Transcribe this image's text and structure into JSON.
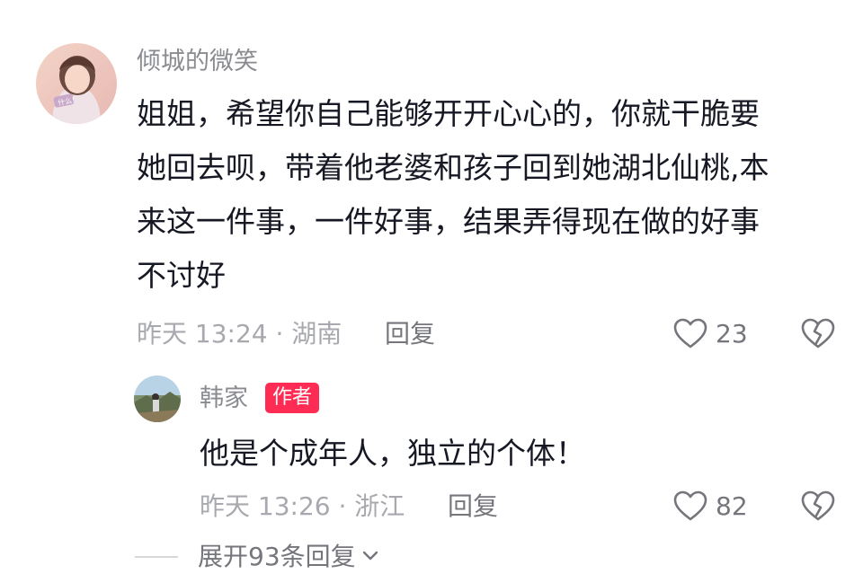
{
  "main_comment": {
    "username": "倾城的微笑",
    "avatar_icon": "avatar-girl-photo",
    "lines": [
      "姐姐，希望你自己能够开开心心的，你就干脆要",
      "她回去呗，带着他老婆和孩子回到她湖北仙桃,本",
      "来这一件事，一件好事，结果弄得现在做的好事",
      "不讨好"
    ],
    "meta": "昨天 13:24 · 湖南",
    "reply_label": "回复",
    "like_count": "23",
    "like_icon": "heart-outline-icon",
    "dislike_icon": "broken-heart-icon"
  },
  "reply_comment": {
    "username": "韩家",
    "badge": "作者",
    "avatar_icon": "avatar-landscape-photo",
    "text": "他是个成年人，独立的个体！",
    "meta": "昨天 13:26 · 浙江",
    "reply_label": "回复",
    "like_count": "82",
    "like_icon": "heart-outline-icon",
    "dislike_icon": "broken-heart-icon"
  },
  "expand": {
    "label": "展开93条回复",
    "icon": "chevron-down-icon"
  },
  "colors": {
    "badge": "#fe2c55",
    "username": "#8a8b91",
    "meta": "#a8a9ae",
    "text": "#161823"
  }
}
